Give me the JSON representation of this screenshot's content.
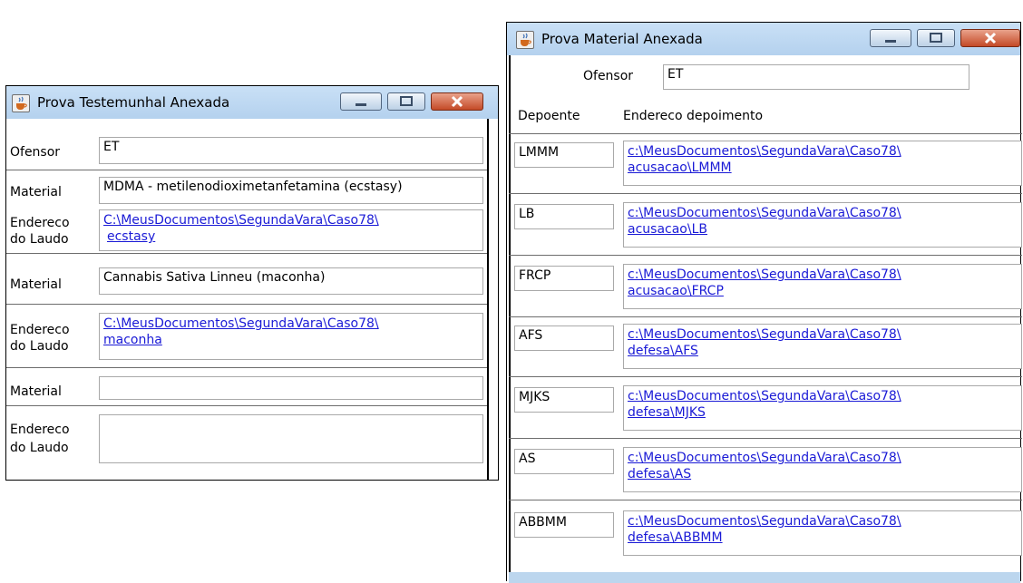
{
  "testemunhal": {
    "title": "Prova Testemunhal Anexada",
    "ofensor_label": "Ofensor",
    "ofensor_value": "ET",
    "material_label": "Material",
    "laudo_label_1": "Endereco",
    "laudo_label_2": "do Laudo",
    "materials": [
      {
        "material": "MDMA - metilenodioximetanfetamina (ecstasy)",
        "laudo_line1": "C:\\MeusDocumentos\\SegundaVara\\Caso78\\",
        "laudo_line2": "ecstasy"
      },
      {
        "material": "Cannabis Sativa Linneu (maconha)",
        "laudo_line1": "C:\\MeusDocumentos\\SegundaVara\\Caso78\\",
        "laudo_line2": "maconha"
      },
      {
        "material": "",
        "laudo_line1": "",
        "laudo_line2": ""
      }
    ]
  },
  "material": {
    "title": "Prova Material Anexada",
    "ofensor_label": "Ofensor",
    "ofensor_value": "ET",
    "col_depoente": "Depoente",
    "col_endereco": "Endereco depoimento",
    "rows": [
      {
        "depoente": "LMMM",
        "line1": "c:\\MeusDocumentos\\SegundaVara\\Caso78\\",
        "line2": "acusacao\\LMMM"
      },
      {
        "depoente": "LB",
        "line1": "c:\\MeusDocumentos\\SegundaVara\\Caso78\\",
        "line2": "acusacao\\LB"
      },
      {
        "depoente": "FRCP",
        "line1": "c:\\MeusDocumentos\\SegundaVara\\Caso78\\",
        "line2": "acusacao\\FRCP"
      },
      {
        "depoente": "AFS",
        "line1": "c:\\MeusDocumentos\\SegundaVara\\Caso78\\",
        "line2": "defesa\\AFS"
      },
      {
        "depoente": "MJKS",
        "line1": "c:\\MeusDocumentos\\SegundaVara\\Caso78\\",
        "line2": "defesa\\MJKS"
      },
      {
        "depoente": "AS",
        "line1": "c:\\MeusDocumentos\\SegundaVara\\Caso78\\",
        "line2": "defesa\\AS"
      },
      {
        "depoente": "ABBMM",
        "line1": "c:\\MeusDocumentos\\SegundaVara\\Caso78\\",
        "line2": "defesa\\ABBMM"
      }
    ]
  },
  "icons": {
    "window_icon": "java-cup-icon",
    "minimize": "minimize-icon",
    "maximize": "maximize-icon",
    "close": "close-icon"
  },
  "colors": {
    "titlebar": "#b4d1ee",
    "link": "#1a1ad6",
    "close_button": "#c44a27"
  }
}
